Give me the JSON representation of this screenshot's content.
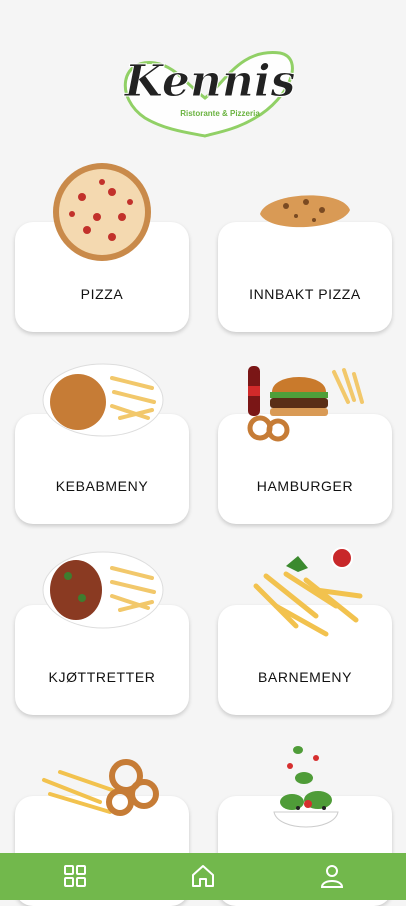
{
  "app": {
    "logo_text": "Kennis",
    "logo_subtitle": "Ristorante & Pizzeria"
  },
  "categories": [
    {
      "label": "PIZZA"
    },
    {
      "label": "INNBAKT PIZZA"
    },
    {
      "label": "KEBABMENY"
    },
    {
      "label": "HAMBURGER"
    },
    {
      "label": "KJØTTRETTER"
    },
    {
      "label": "BARNEMENY"
    },
    {
      "label": ""
    },
    {
      "label": ""
    }
  ],
  "nav": {
    "items": [
      {
        "icon": "grid-icon"
      },
      {
        "icon": "home-icon"
      },
      {
        "icon": "user-icon"
      }
    ]
  },
  "colors": {
    "accent": "#72b84c",
    "background": "#f5f5f5"
  }
}
